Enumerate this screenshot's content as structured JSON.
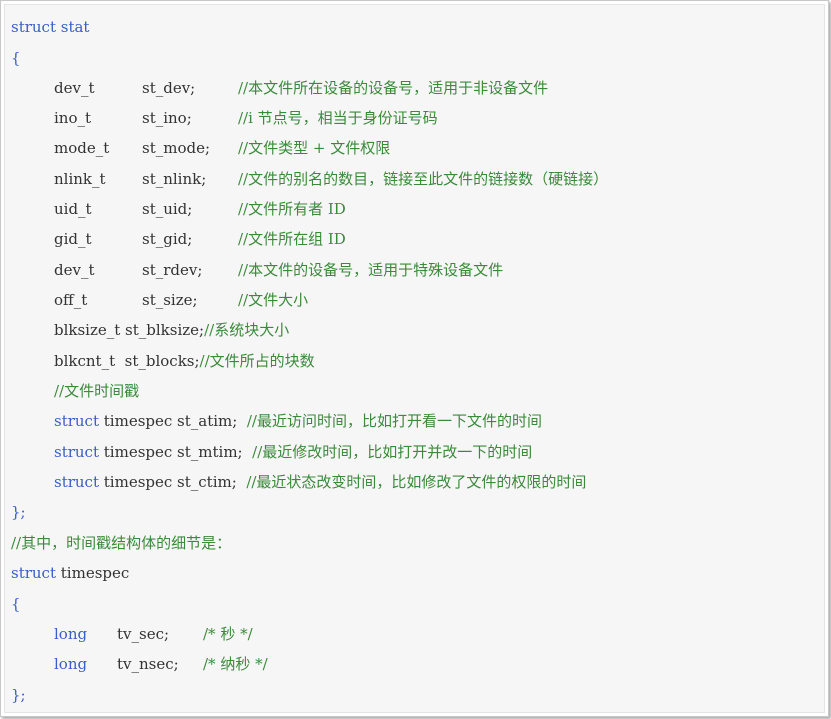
{
  "code": {
    "struct_stat_header": "struct stat",
    "open_brace": "{",
    "fields": [
      {
        "type": "dev_t",
        "member": "st_dev;",
        "comment": "//本文件所在设备的设备号，适用于非设备文件"
      },
      {
        "type": "ino_t",
        "member": "st_ino;",
        "comment": "//i 节点号，相当于身份证号码"
      },
      {
        "type": "mode_t",
        "member": "st_mode;",
        "comment": "//文件类型 + 文件权限"
      },
      {
        "type": "nlink_t",
        "member": "st_nlink;",
        "comment": "//文件的别名的数目，链接至此文件的链接数（硬链接）"
      },
      {
        "type": "uid_t",
        "member": "st_uid;",
        "comment": "//文件所有者 ID"
      },
      {
        "type": "gid_t",
        "member": "st_gid;",
        "comment": "//文件所在组 ID"
      },
      {
        "type": "dev_t",
        "member": "st_rdev;",
        "comment": "//本文件的设备号，适用于特殊设备文件"
      },
      {
        "type": "off_t",
        "member": "st_size;",
        "comment": "//文件大小"
      }
    ],
    "blksize_line": {
      "text": "blksize_t st_blksize;",
      "comment": "//系统块大小"
    },
    "blkcnt_line": {
      "text": "blkcnt_t  st_blocks;",
      "comment": "//文件所占的块数"
    },
    "time_comment": "//文件时间戳",
    "time_fields": [
      {
        "keyword": "struct",
        "decl": " timespec st_atim;  ",
        "comment": "//最近访问时间，比如打开看一下文件的时间"
      },
      {
        "keyword": "struct",
        "decl": " timespec st_mtim;  ",
        "comment": "//最近修改时间，比如打开并改一下的时间"
      },
      {
        "keyword": "struct",
        "decl": " timespec st_ctim;  ",
        "comment": "//最近状态改变时间，比如修改了文件的权限的时间"
      }
    ],
    "close_brace": "};",
    "timespec_intro_comment": "//其中，时间戳结构体的细节是：",
    "struct_timespec_keyword": "struct",
    "struct_timespec_name": " timespec",
    "ts_open_brace": "{",
    "ts_fields": [
      {
        "type": "long",
        "member": "tv_sec;",
        "comment": "/* 秒 */"
      },
      {
        "type": "long",
        "member": "tv_nsec;",
        "comment": "/* 纳秒 */"
      }
    ],
    "ts_close_brace": "};",
    "colors": {
      "keyword": "#3a5ec9",
      "comment": "#3b8a3b",
      "text": "#333333",
      "background": "#f6f6f6"
    }
  }
}
